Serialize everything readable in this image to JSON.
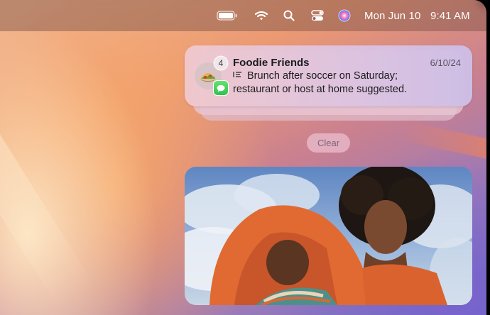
{
  "menubar": {
    "date": "Mon Jun 10",
    "time": "9:41 AM",
    "icons": [
      "battery-icon",
      "wifi-icon",
      "search-icon",
      "control-center-icon",
      "siri-icon"
    ]
  },
  "notification": {
    "group_count": "4",
    "title": "Foodie Friends",
    "date": "6/10/24",
    "summary_line1": "Brunch after soccer on Saturday;",
    "summary_line2": "restaurant or host at home suggested.",
    "app_icon": "messages-icon",
    "avatar_emoji": "🌮"
  },
  "clear_label": "Clear",
  "colors": {
    "accent_green": "#34c759",
    "card_pink": "#f0c8cd",
    "orange_cloth": "#e0602a"
  }
}
